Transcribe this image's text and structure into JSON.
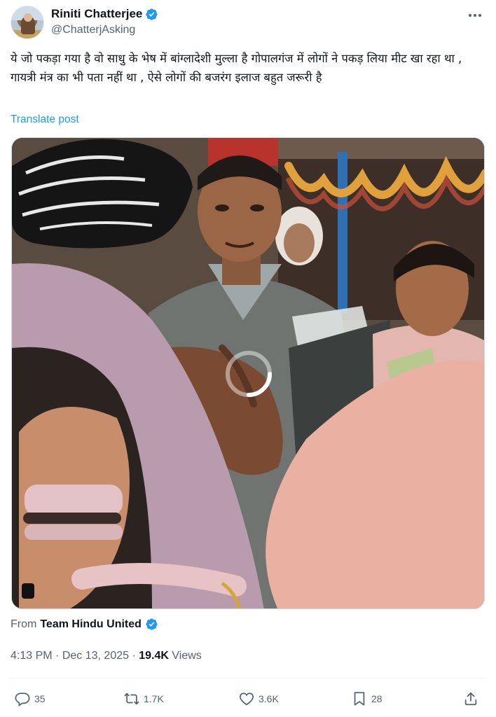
{
  "author": {
    "name": "Riniti Chatterjee",
    "handle": "@ChatterjAsking",
    "verified": true
  },
  "tweet": {
    "text": "ये जो पकड़ा गया है वो साधु के भेष में बांग्लादेशी मुल्ला है गोपालगंज में लोगों ने पकड़ लिया मीट खा रहा था , गायत्री मंत्र का भी पता नहीं था , ऐसे लोगों की बजरंग इलाज बहुत जरूरी है",
    "translate_label": "Translate post"
  },
  "media": {
    "type": "video",
    "state": "loading"
  },
  "source": {
    "prefix": "From",
    "name": "Team Hindu United",
    "verified": true
  },
  "meta": {
    "time": "4:13 PM",
    "separator": "·",
    "date": "Dec 13, 2025",
    "views_count": "19.4K",
    "views_label": "Views"
  },
  "actions": {
    "replies": "35",
    "reposts": "1.7K",
    "likes": "3.6K",
    "bookmarks": "28"
  },
  "colors": {
    "verified_blue": "#1d9bf0",
    "link_blue": "#1d9bf0",
    "secondary_text": "#536471"
  }
}
